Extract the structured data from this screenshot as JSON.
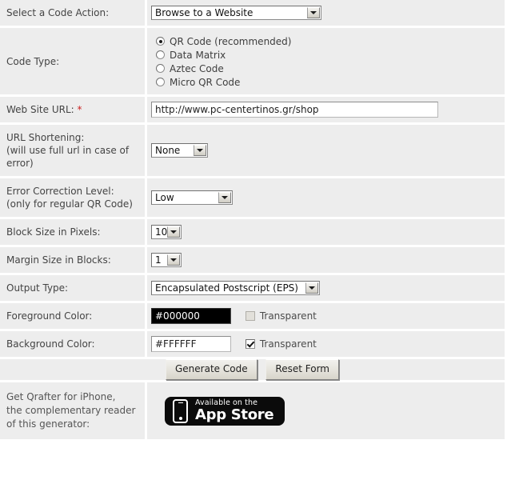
{
  "form": {
    "rows": [
      {
        "label": "Select a Code Action:",
        "control": "select",
        "value": "Browse to a Website"
      },
      {
        "label": "Code Type:",
        "control": "radio-group",
        "options": [
          {
            "label": "QR Code (recommended)",
            "checked": true
          },
          {
            "label": "Data Matrix",
            "checked": false
          },
          {
            "label": "Aztec Code",
            "checked": false
          },
          {
            "label": "Micro QR Code",
            "checked": false
          }
        ]
      },
      {
        "label": "Web Site URL:",
        "required_marker": "*",
        "control": "text",
        "value": "http://www.pc-centertinos.gr/shop",
        "placeholder": ""
      },
      {
        "label_lines": [
          "URL Shortening:",
          "(will use full url in case of",
          "error)"
        ],
        "control": "select",
        "value": "None"
      },
      {
        "label_lines": [
          "Error Correction Level:",
          "(only for regular QR Code)"
        ],
        "control": "select",
        "value": "Low"
      },
      {
        "label": "Block Size in Pixels:",
        "control": "select",
        "value": "10"
      },
      {
        "label": "Margin Size in Blocks:",
        "control": "select",
        "value": "1"
      },
      {
        "label": "Output Type:",
        "control": "select",
        "value": "Encapsulated Postscript (EPS)"
      },
      {
        "label": "Foreground Color:",
        "control": "color",
        "value": "#000000",
        "checkbox_label": "Transparent",
        "checked": false,
        "disabled": true
      },
      {
        "label": "Background Color:",
        "control": "color",
        "value": "#FFFFFF",
        "checkbox_label": "Transparent",
        "checked": true,
        "disabled": false
      }
    ],
    "labels": {
      "code_action": "Select a Code Action:",
      "code_type": "Code Type:",
      "web_site_url": "Web Site URL:",
      "required_star": "*",
      "url_shortening_l1": "URL Shortening:",
      "url_shortening_l2": "(will use full url in case of",
      "url_shortening_l3": "error)",
      "error_correction_l1": "Error Correction Level:",
      "error_correction_l2": "(only for regular QR Code)",
      "block_size": "Block Size in Pixels:",
      "margin_size": "Margin Size in Blocks:",
      "output_type": "Output Type:",
      "foreground_color": "Foreground Color:",
      "background_color": "Background Color:"
    },
    "values": {
      "code_action": "Browse to a Website",
      "url": "http://www.pc-centertinos.gr/shop",
      "url_shortening": "None",
      "error_correction": "Low",
      "block_size": "10",
      "margin_size": "1",
      "output_type": "Encapsulated Postscript (EPS)",
      "foreground_color": "#000000",
      "background_color": "#FFFFFF"
    },
    "radio_options": [
      "QR Code (recommended)",
      "Data Matrix",
      "Aztec Code",
      "Micro QR Code"
    ],
    "transparent_label": "Transparent",
    "buttons": {
      "generate": "Generate Code",
      "reset": "Reset Form"
    }
  },
  "footer": {
    "promo_l1": "Get Qrafter for iPhone,",
    "promo_l2": "the complementary reader",
    "promo_l3": "of this generator:",
    "appstore": {
      "small": "Available on the",
      "big": "App Store"
    }
  },
  "colors": {
    "cell_bg": "#ededed",
    "separator": "#ffffff",
    "required": "#cc2222",
    "foreground_swatch": "#000000",
    "background_swatch": "#ffffff"
  }
}
